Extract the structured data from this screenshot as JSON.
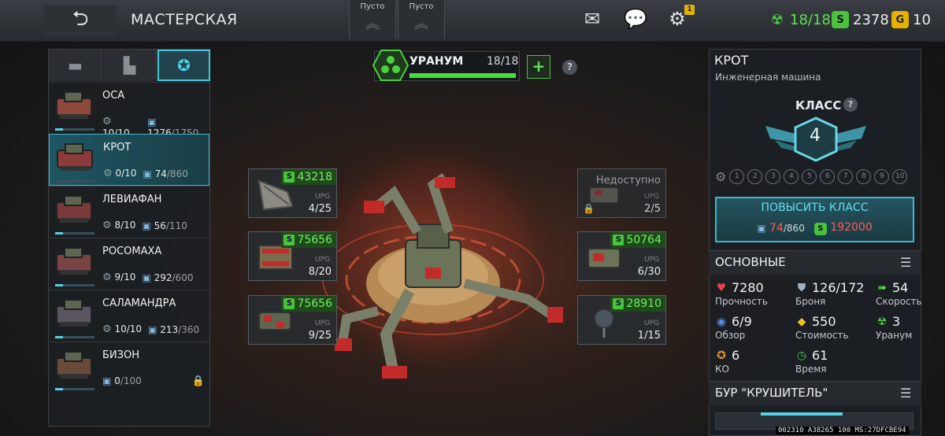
{
  "header": {
    "title": "МАСТЕРСКАЯ",
    "slots": [
      {
        "label": "Пусто"
      },
      {
        "label": "Пусто"
      }
    ],
    "settings_badge": "1",
    "resources": {
      "uranium": "18/18",
      "money": "2378",
      "gold": "10"
    }
  },
  "left_tabs": [
    "tank-icon",
    "factory-icon",
    "wings-badge-icon"
  ],
  "vehicles": [
    {
      "name": "ОСА",
      "upgrades": "10/10",
      "cards": "1276",
      "cards_max": "/1750",
      "progress": 0.2,
      "locked": false,
      "selected": false
    },
    {
      "name": "КРОТ",
      "upgrades": "0/10",
      "cards": "74",
      "cards_max": "/860",
      "progress": 0.0,
      "locked": false,
      "selected": true
    },
    {
      "name": "ЛЕВИАФАН",
      "upgrades": "8/10",
      "cards": "56",
      "cards_max": "/110",
      "progress": 0.2,
      "locked": false,
      "selected": false
    },
    {
      "name": "РОСОМАХА",
      "upgrades": "9/10",
      "cards": "292",
      "cards_max": "/600",
      "progress": 0.2,
      "locked": false,
      "selected": false
    },
    {
      "name": "САЛАМАНДРА",
      "upgrades": "10/10",
      "cards": "213",
      "cards_max": "/360",
      "progress": 0.2,
      "locked": false,
      "selected": false
    },
    {
      "name": "БИЗОН",
      "upgrades": "",
      "cards": "0",
      "cards_max": "/100",
      "progress": 0.2,
      "locked": true,
      "selected": false
    }
  ],
  "uranium": {
    "label": "УРАНУМ",
    "count": "18/18",
    "fill": 1.0,
    "plus": "+",
    "help": "?"
  },
  "upgrades_left": [
    {
      "price": "43218",
      "cap": "UPG",
      "level": "4/25"
    },
    {
      "price": "75656",
      "cap": "UPG",
      "level": "8/20"
    },
    {
      "price": "75656",
      "cap": "UPG",
      "level": "9/25"
    }
  ],
  "upgrades_right": [
    {
      "price": "",
      "unavailable": "Недоступно",
      "cap": "UPG",
      "level": "2/5"
    },
    {
      "price": "50764",
      "cap": "UPG",
      "level": "6/30"
    },
    {
      "price": "28910",
      "cap": "UPG",
      "level": "1/15"
    }
  ],
  "detail": {
    "name": "КРОТ",
    "type": "Инженерная машина",
    "class_label": "КЛАСС",
    "class_help": "?",
    "class_value": "4",
    "class_levels": [
      "1",
      "2",
      "3",
      "4",
      "5",
      "6",
      "7",
      "8",
      "9",
      "10"
    ],
    "upgrade_label": "ПОВЫСИТЬ КЛАСС",
    "upgrade_cards": "74",
    "upgrade_cards_max": "/860",
    "upgrade_money": "192000",
    "section_main": "ОСНОВНЫЕ",
    "stats": [
      {
        "icon": "heart-icon",
        "value": "7280",
        "label": "Прочность",
        "color": "#e8424a"
      },
      {
        "icon": "armor-icon",
        "value": "126/172",
        "label": "Броня",
        "color": "#9fb3c4"
      },
      {
        "icon": "speed-arrow-icon",
        "value": "54",
        "label": "Скорость",
        "color": "#56e04a"
      },
      {
        "icon": "eye-icon",
        "value": "6/9",
        "label": "Обзор",
        "color": "#5a8de8"
      },
      {
        "icon": "cube-icon",
        "value": "550",
        "label": "Стоимость",
        "color": "#f0c21e"
      },
      {
        "icon": "uranium-icon",
        "value": "3",
        "label": "Уранум",
        "color": "#4bd13e"
      },
      {
        "icon": "star-badge-icon",
        "value": "6",
        "label": "КО",
        "color": "#e8962b"
      },
      {
        "icon": "clock-icon",
        "value": "61",
        "label": "Время",
        "color": "#49c94d"
      }
    ],
    "section_weapon": "БУР \"КРУШИТЕЛЬ\""
  },
  "debug_code": "002310 A38265 100 MS:27DFCBE94",
  "colors": {
    "accent": "#42c6dd",
    "money": "#71f064",
    "red": "#ff5a5a"
  }
}
